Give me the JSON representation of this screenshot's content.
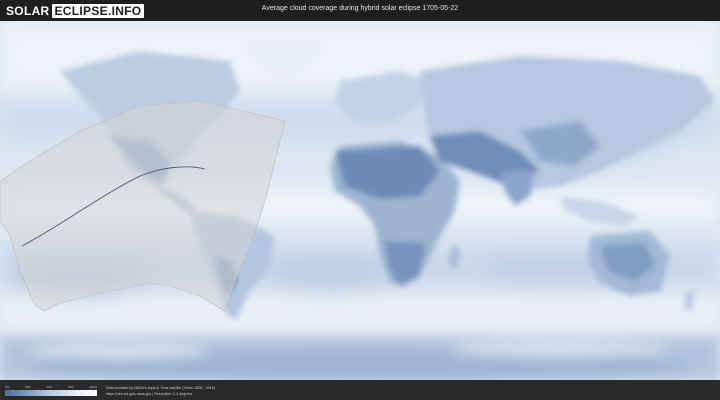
{
  "header": {
    "logo_left": "SOLAR",
    "logo_right": "ECLIPSE.INFO",
    "title": "Average cloud coverage during hybrid solar eclipse 1705-05-22"
  },
  "map": {
    "colors": {
      "cloud_white": "#f4f8fc",
      "clear_sky_blue": "#7f9cc2",
      "dark_clear": "#5f7fae",
      "eclipse_zone": "#d8d8d8",
      "path_line": "#4a5a7a"
    }
  },
  "legend": {
    "ticks": [
      "0%",
      "25%",
      "50%",
      "75%",
      "100%"
    ],
    "gradient_start": "#4d6f9e",
    "gradient_end": "#ffffff"
  },
  "footer": {
    "credit_line1": "Data provided by NASA's Aqua & Terra satellite (Years: 2000 - 2019)",
    "credit_line2": "https://neo.sci.gsfc.nasa.gov  |  Resolution: 0.1 degrees"
  }
}
